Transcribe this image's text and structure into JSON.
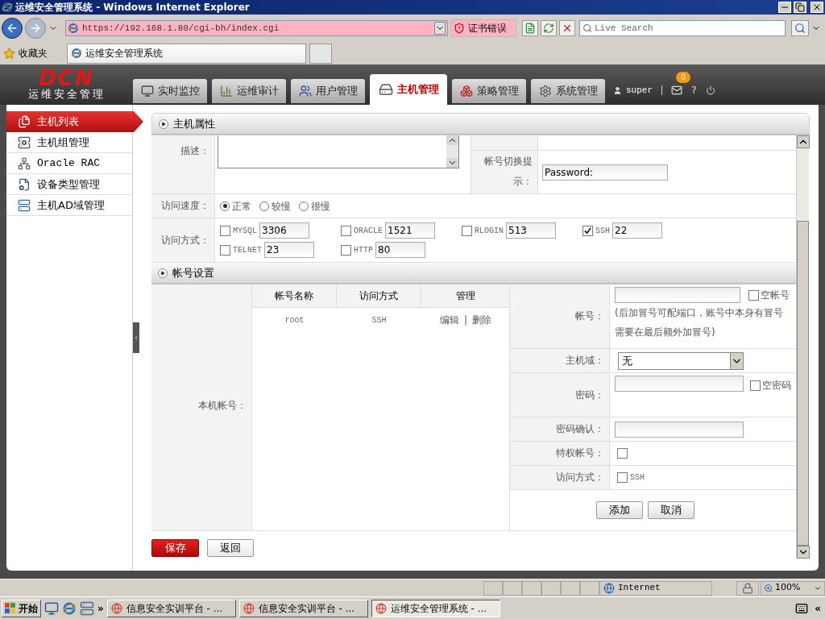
{
  "browser": {
    "title": "运维安全管理系统 - Windows Internet Explorer",
    "address": "https://192.168.1.80/cgi-bh/index.cgi",
    "cert_error": "证书错误",
    "search_placeholder": "Live Search",
    "favorites": "收藏夹",
    "tab_title": "运维安全管理系统"
  },
  "app": {
    "logo": "DCN",
    "logo_subtitle": "运维安全管理",
    "user": "super",
    "mail_badge": "0",
    "help": "?",
    "nav": [
      {
        "label": "实时监控",
        "selected": false
      },
      {
        "label": "运维审计",
        "selected": false
      },
      {
        "label": "用户管理",
        "selected": false
      },
      {
        "label": "主机管理",
        "selected": true
      },
      {
        "label": "策略管理",
        "selected": false
      },
      {
        "label": "系统管理",
        "selected": false
      }
    ]
  },
  "sidebar": [
    {
      "label": "主机列表",
      "selected": true
    },
    {
      "label": "主机组管理",
      "selected": false
    },
    {
      "label": "Oracle RAC",
      "selected": false
    },
    {
      "label": "设备类型管理",
      "selected": false
    },
    {
      "label": "主机AD域管理",
      "selected": false
    }
  ],
  "host_section": {
    "title": "主机属性",
    "description_label": "描述：",
    "switch_prompt_label": "帐号切换提示：",
    "switch_prompt_value": "Password:",
    "speed_label": "访问速度：",
    "speeds": [
      {
        "label": "正常",
        "selected": true
      },
      {
        "label": "较慢",
        "selected": false
      },
      {
        "label": "很慢",
        "selected": false
      }
    ],
    "access_label": "访问方式：",
    "protocols": [
      {
        "name": "MYSQL",
        "port": "3306",
        "checked": false
      },
      {
        "name": "ORACLE",
        "port": "1521",
        "checked": false
      },
      {
        "name": "RLOGIN",
        "port": "513",
        "checked": false
      },
      {
        "name": "SSH",
        "port": "22",
        "checked": true
      },
      {
        "name": "TELNET",
        "port": "23",
        "checked": false
      },
      {
        "name": "HTTP",
        "port": "80",
        "checked": false
      }
    ]
  },
  "account_section": {
    "title": "帐号设置",
    "local_label": "本机帐号：",
    "columns": [
      "帐号名称",
      "访问方式",
      "管理"
    ],
    "rows": [
      {
        "name": "root",
        "method": "SSH",
        "edit": "编辑",
        "separator": "|",
        "delete": "删除"
      }
    ],
    "form": {
      "account_label": "帐号：",
      "empty_account": {
        "label": "空帐号",
        "checked": false
      },
      "hint": "(后加冒号可配端口，账号中本身有冒号需要在最后额外加冒号)",
      "domain_label": "主机域：",
      "domain_value": "无",
      "password_label": "密码：",
      "empty_password": {
        "label": "空密码",
        "checked": false
      },
      "confirm_label": "密码确认：",
      "privileged_label": "特权帐号：",
      "privileged_checked": false,
      "access_label": "访问方式：",
      "access_option": {
        "label": "SSH",
        "checked": false
      },
      "add": "添加",
      "cancel": "取消"
    }
  },
  "buttons": {
    "save": "保存",
    "back": "返回"
  },
  "status_bar": {
    "zone": "Internet",
    "zoom": "100%"
  },
  "taskbar": {
    "start": "开始",
    "chevron": "»",
    "collapse": "«",
    "tasks": [
      {
        "label": "信息安全实训平台 - ...",
        "selected": false
      },
      {
        "label": "信息安全实训平台 - ...",
        "selected": false
      },
      {
        "label": "运维安全管理系统 - ...",
        "selected": true
      }
    ]
  }
}
